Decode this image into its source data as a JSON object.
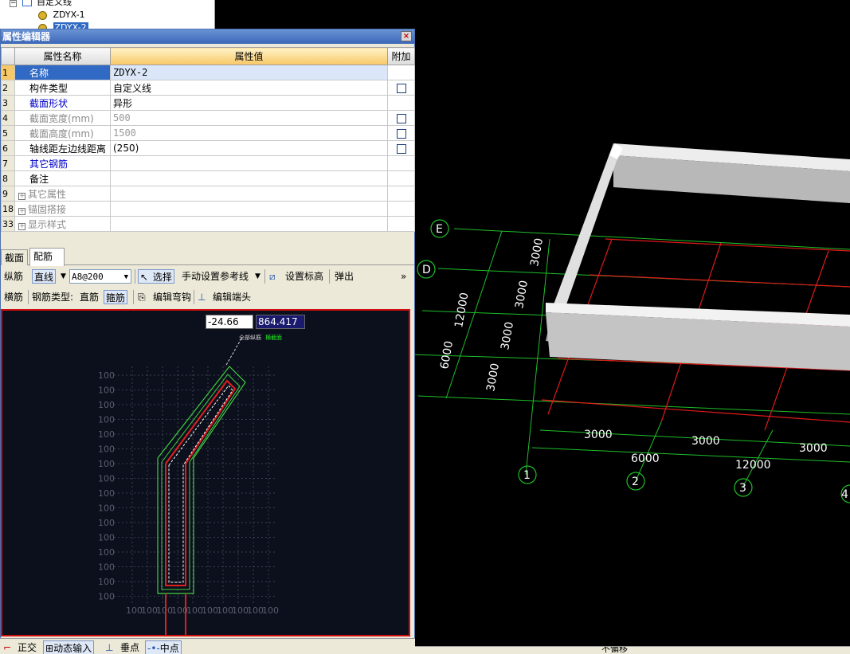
{
  "tree": {
    "root_label": "自定义线",
    "items": [
      "ZDYX-1",
      "ZDYX-2"
    ]
  },
  "editor": {
    "title": "属性编辑器",
    "columns": {
      "name": "属性名称",
      "value": "属性值",
      "extra": "附加"
    },
    "rows": [
      {
        "num": "1",
        "name": "名称",
        "value": "ZDYX-2"
      },
      {
        "num": "2",
        "name": "构件类型",
        "value": "自定义线"
      },
      {
        "num": "3",
        "name": "截面形状",
        "value": "异形"
      },
      {
        "num": "4",
        "name": "截面宽度(mm)",
        "value": "500"
      },
      {
        "num": "5",
        "name": "截面高度(mm)",
        "value": "1500"
      },
      {
        "num": "6",
        "name": "轴线距左边线距离",
        "value": "(250)"
      },
      {
        "num": "7",
        "name": "其它钢筋",
        "value": ""
      },
      {
        "num": "8",
        "name": "备注",
        "value": ""
      },
      {
        "num": "9",
        "name": "其它属性",
        "value": ""
      },
      {
        "num": "18",
        "name": "锚固搭接",
        "value": ""
      },
      {
        "num": "33",
        "name": "显示样式",
        "value": ""
      }
    ]
  },
  "tabs": [
    "截面",
    "配筋"
  ],
  "toolbar1": {
    "label": "纵筋",
    "line_type": "直线",
    "rebar_value": "A8@200",
    "select": "选择",
    "manual_ref": "手动设置参考线",
    "set_elev": "设置标高",
    "popup": "弹出",
    "more": "»"
  },
  "toolbar2": {
    "label": "横筋",
    "type_label": "钢筋类型:",
    "straight": "直筋",
    "stirrup": "箍筋",
    "edit_hook": "编辑弯钩",
    "edit_end": "编辑端头"
  },
  "section": {
    "coord_x": "-24.66",
    "coord_y": "864.417",
    "label_all": "全部纵筋",
    "label_stirrup": "横截面",
    "tick": "100"
  },
  "status": {
    "ortho": "正交",
    "dynamic": "动态输入",
    "perp": "垂点",
    "mid": "中点"
  },
  "viewport": {
    "axis_rows": [
      "E",
      "D"
    ],
    "axis_cols": [
      "1",
      "2",
      "3",
      "4"
    ],
    "dims_vertical": [
      "3000",
      "3000",
      "3000",
      "3000"
    ],
    "dims_vertical_total": [
      "12000",
      "6000"
    ],
    "dims_horizontal": [
      "3000",
      "3000",
      "3000"
    ],
    "dims_horizontal_total": [
      "6000",
      "12000"
    ]
  },
  "right_status": "不偏移"
}
